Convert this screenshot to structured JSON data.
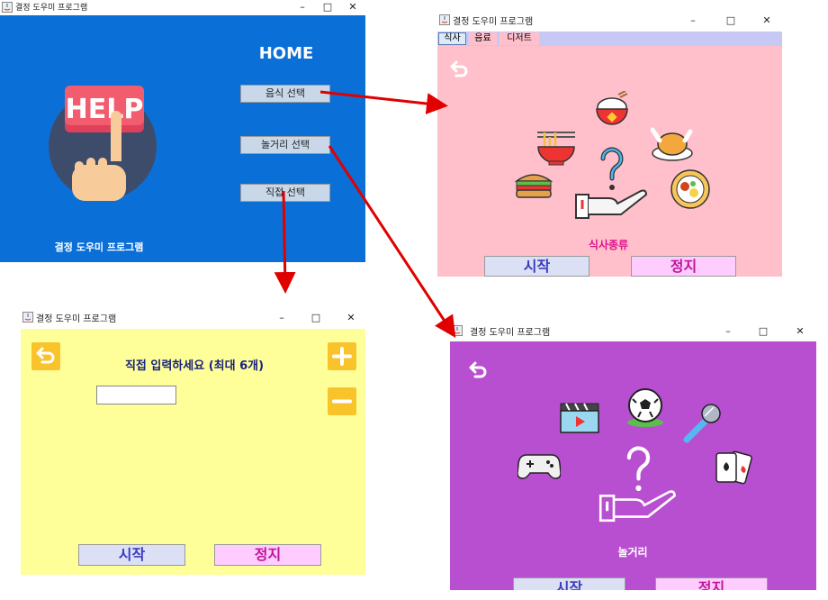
{
  "app_title": "결정 도우미 프로그램",
  "window_controls": {
    "minimize": "–",
    "maximize": "□",
    "close": "✕"
  },
  "home": {
    "heading": "HOME",
    "help_sign": "HELP",
    "buttons": {
      "food": "음식 선택",
      "play": "놀거리 선택",
      "custom": "직접 선택"
    },
    "footer": "결정 도우미 프로그램",
    "bg_color": "#0a6fd6"
  },
  "food": {
    "tabs": [
      "식사",
      "음료",
      "디저트"
    ],
    "result_label": "식사종류",
    "start_button": "시작",
    "stop_button": "정지",
    "bg_color": "#ffc0cb"
  },
  "custom": {
    "prompt": "직접 입력하세요 (최대 6개)",
    "input_value": "",
    "start_button": "시작",
    "stop_button": "정지",
    "bg_color": "#ffff99"
  },
  "play": {
    "result_label": "놀거리",
    "start_button": "시작",
    "stop_button": "정지",
    "bg_color": "#b84fd0"
  },
  "icons": {
    "back": "back-arrow-icon",
    "plus": "plus-icon",
    "minus": "minus-icon",
    "help_hand": "help-hand-icon",
    "question_hand": "question-hand-icon"
  }
}
